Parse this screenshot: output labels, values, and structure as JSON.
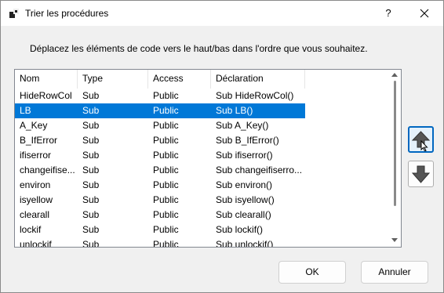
{
  "window": {
    "title": "Trier les procédures",
    "help_label": "?"
  },
  "instruction": "Déplacez les éléments de code vers le haut/bas dans l'ordre que vous souhaitez.",
  "list": {
    "columns": [
      "Nom",
      "Type",
      "Access",
      "Déclaration"
    ],
    "selected_index": 1,
    "rows": [
      [
        "HideRowCol",
        "Sub",
        "Public",
        "Sub HideRowCol()"
      ],
      [
        "LB",
        "Sub",
        "Public",
        "Sub LB()"
      ],
      [
        "A_Key",
        "Sub",
        "Public",
        "Sub A_Key()"
      ],
      [
        "B_IfError",
        "Sub",
        "Public",
        "Sub B_IfError()"
      ],
      [
        "ifiserror",
        "Sub",
        "Public",
        "Sub ifiserror()"
      ],
      [
        "changeifise...",
        "Sub",
        "Public",
        "Sub changeifiserro..."
      ],
      [
        "environ",
        "Sub",
        "Public",
        "Sub environ()"
      ],
      [
        "isyellow",
        "Sub",
        "Public",
        "Sub isyellow()"
      ],
      [
        "clearall",
        "Sub",
        "Public",
        "Sub clearall()"
      ],
      [
        "lockif",
        "Sub",
        "Public",
        "Sub lockif()"
      ],
      [
        "unlockif",
        "Sub",
        "Public",
        "Sub unlockif()"
      ]
    ]
  },
  "buttons": {
    "ok": "OK",
    "cancel": "Annuler",
    "move_up_icon": "arrow-up-icon",
    "move_down_icon": "arrow-down-icon"
  },
  "colors": {
    "selection": "#0078d7",
    "focus_border": "#0067c0"
  }
}
